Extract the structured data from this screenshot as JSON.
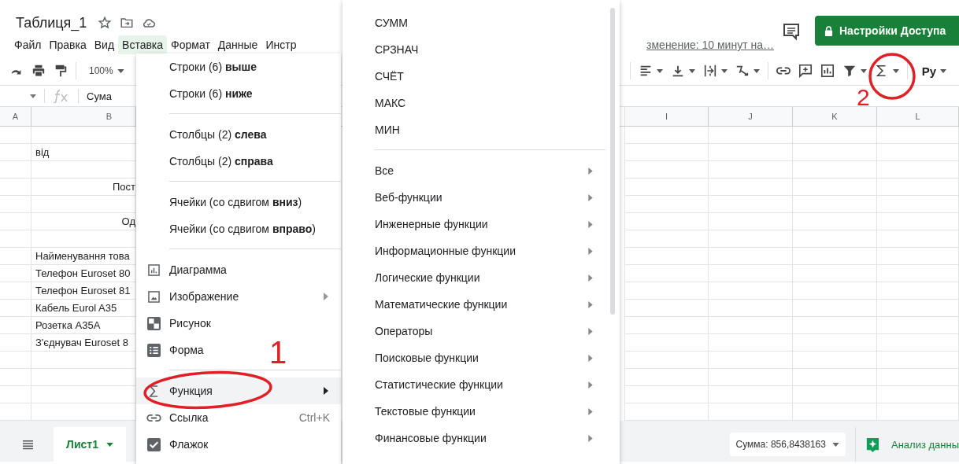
{
  "document": {
    "title": "Таблиця_1",
    "last_edit": "зменение: 10 минут на…"
  },
  "menu_bar": [
    {
      "label": "Файл",
      "selected": false
    },
    {
      "label": "Правка",
      "selected": false
    },
    {
      "label": "Вид",
      "selected": false
    },
    {
      "label": "Вставка",
      "selected": true
    },
    {
      "label": "Формат",
      "selected": false
    },
    {
      "label": "Данные",
      "selected": false
    },
    {
      "label": "Инстр",
      "selected": false
    }
  ],
  "share_button": {
    "label": "Настройки Доступа"
  },
  "toolbar": {
    "zoom": "100%",
    "input_tools": "Pу"
  },
  "formula_bar": {
    "value": "Сума"
  },
  "columns": {
    "left": [
      "A",
      "B"
    ],
    "right": [
      "I",
      "J",
      "K",
      "L"
    ]
  },
  "rows": [
    {},
    {
      "b": "від",
      "kind": "text"
    },
    {},
    {
      "b": "Пост",
      "kind": "heading"
    },
    {},
    {
      "b": "Од",
      "kind": "heading"
    },
    {},
    {
      "b": "Найменування това",
      "kind": "text"
    },
    {
      "b": "Телефон Euroset 80",
      "kind": "text"
    },
    {
      "b": "Телефон Euroset 81",
      "kind": "text"
    },
    {
      "b": "Кабель  Eurol A35",
      "kind": "text"
    },
    {
      "b": "Розетка A35A",
      "kind": "text"
    },
    {
      "b": "З'єднувач Euroset 8",
      "kind": "text"
    },
    {},
    {},
    {},
    {}
  ],
  "sheet_tabs": [
    {
      "label": "Лист1",
      "selected": true
    }
  ],
  "status": {
    "sum": "Сумма: 856,8438163",
    "explore": "Анализ данны"
  },
  "insert_menu": {
    "sections": [
      {
        "items": [
          {
            "label": "Строки (6) **выше**",
            "selected": false,
            "submenu": false
          },
          {
            "label": "Строки (6) **ниже**",
            "selected": false,
            "submenu": false
          }
        ]
      },
      {
        "items": [
          {
            "label": "Столбцы (2) **слева**",
            "selected": false,
            "submenu": false
          },
          {
            "label": "Столбцы (2) **справа**",
            "selected": false,
            "submenu": false
          }
        ]
      },
      {
        "items": [
          {
            "label": "Ячейки (со сдвигом **вниз**)",
            "selected": false,
            "submenu": false
          },
          {
            "label": "Ячейки (со сдвигом **вправо**)",
            "selected": false,
            "submenu": false
          }
        ]
      },
      {
        "items": [
          {
            "label": "Диаграмма",
            "kind": "chart",
            "selected": false,
            "submenu": false
          },
          {
            "label": "Изображение",
            "kind": "image",
            "selected": false,
            "submenu": true
          },
          {
            "label": "Рисунок",
            "kind": "drawing",
            "selected": false,
            "submenu": false
          },
          {
            "label": "Форма",
            "kind": "form",
            "selected": false,
            "submenu": false
          }
        ]
      },
      {
        "items": [
          {
            "label": "Функция",
            "kind": "function",
            "selected": true,
            "submenu": true
          },
          {
            "label": "Ссылка",
            "kind": "link",
            "shortcut": "Ctrl+K",
            "selected": false,
            "submenu": false
          },
          {
            "label": "Флажок",
            "kind": "checkbox",
            "selected": false,
            "submenu": false
          }
        ]
      }
    ]
  },
  "function_menu": {
    "common": [
      "СУММ",
      "СРЗНАЧ",
      "СЧЁТ",
      "МАКС",
      "МИН"
    ],
    "categories": [
      "Все",
      "Веб-функции",
      "Инженерные функции",
      "Информационные функции",
      "Логические функции",
      "Математические функции",
      "Операторы",
      "Поисковые функции",
      "Статистические функции",
      "Текстовые функции",
      "Финансовые функции"
    ]
  },
  "annotations": [
    {
      "label": "1"
    },
    {
      "label": "2"
    }
  ]
}
